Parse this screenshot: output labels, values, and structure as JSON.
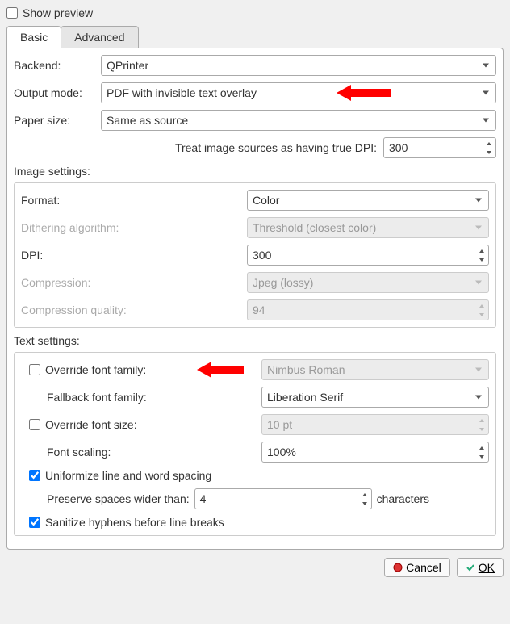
{
  "show_preview_label": "Show preview",
  "show_preview_checked": false,
  "tabs": {
    "basic": "Basic",
    "advanced": "Advanced"
  },
  "labels": {
    "backend": "Backend:",
    "output_mode": "Output mode:",
    "paper_size": "Paper size:",
    "treat_dpi": "Treat image sources as having true DPI:",
    "image_settings": "Image settings:",
    "format": "Format:",
    "dithering": "Dithering algorithm:",
    "dpi": "DPI:",
    "compression": "Compression:",
    "comp_quality": "Compression quality:",
    "text_settings": "Text settings:",
    "override_font_family": "Override font family:",
    "fallback_font": "Fallback font family:",
    "override_font_size": "Override font size:",
    "font_scaling": "Font scaling:",
    "uniformize": "Uniformize line and word spacing",
    "preserve_spaces": "Preserve spaces wider than:",
    "characters": "characters",
    "sanitize": "Sanitize hyphens before line breaks"
  },
  "values": {
    "backend": "QPrinter",
    "output_mode": "PDF with invisible text overlay",
    "paper_size": "Same as source",
    "treat_dpi": "300",
    "format": "Color",
    "dithering": "Threshold (closest color)",
    "dpi": "300",
    "compression": "Jpeg (lossy)",
    "comp_quality": "94",
    "override_font_family": "Nimbus Roman",
    "fallback_font": "Liberation Serif",
    "override_font_size": "10 pt",
    "font_scaling": "100%",
    "preserve_spaces": "4"
  },
  "checks": {
    "override_font_family": false,
    "override_font_size": false,
    "uniformize": true,
    "sanitize": true
  },
  "buttons": {
    "cancel": "Cancel",
    "ok": "OK"
  }
}
